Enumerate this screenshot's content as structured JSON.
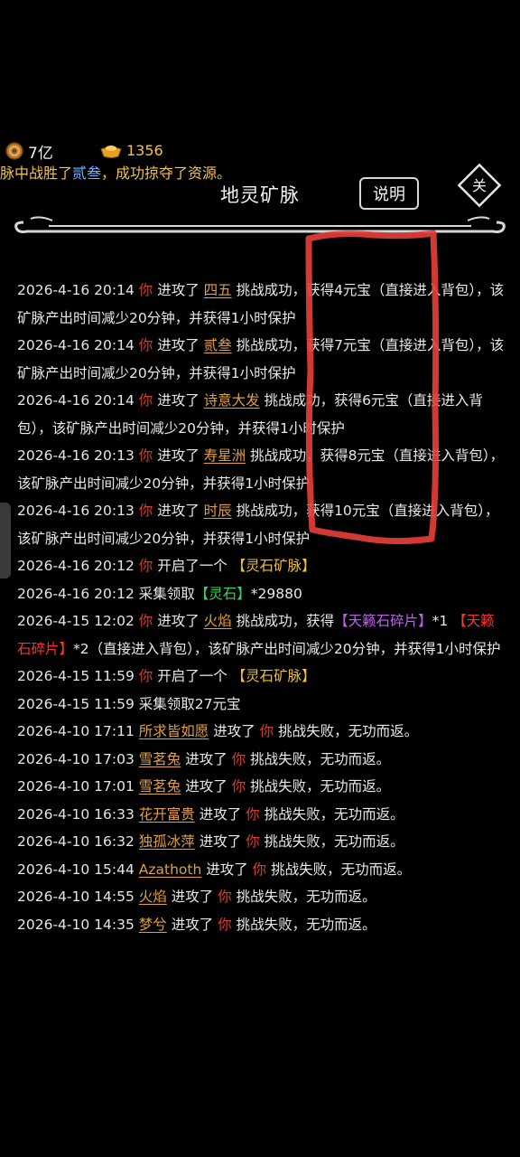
{
  "header": {
    "coins": "7亿",
    "ingots": "1356",
    "ticker_prefix": "脉中战胜了",
    "ticker_name": "贰叁",
    "ticker_suffix": "，成功掠夺了资源。",
    "title": "地灵矿脉",
    "help_label": "说明",
    "close_label": "关"
  },
  "log": {
    "rows": [
      {
        "ts": "2026-4-16 20:14",
        "you": "你",
        "verb": " 进攻了 ",
        "player": "四五",
        "rest": " 挑战成功，获得4元宝（直接进入背包），该矿脉产出时间减少20分钟，并获得1小时保护"
      },
      {
        "ts": "2026-4-16 20:14",
        "you": "你",
        "verb": " 进攻了 ",
        "player": "贰叁",
        "rest": " 挑战成功，获得7元宝（直接进入背包），该矿脉产出时间减少20分钟，并获得1小时保护"
      },
      {
        "ts": "2026-4-16 20:14",
        "you": "你",
        "verb": " 进攻了 ",
        "player": "诗意大发",
        "rest": " 挑战成功，获得6元宝（直接进入背包），该矿脉产出时间减少20分钟，并获得1小时保护"
      },
      {
        "ts": "2026-4-16 20:13",
        "you": "你",
        "verb": " 进攻了 ",
        "player": "寿星洲",
        "rest": " 挑战成功，获得8元宝（直接进入背包），该矿脉产出时间减少20分钟，并获得1小时保护"
      },
      {
        "ts": "2026-4-16 20:13",
        "you": "你",
        "verb": " 进攻了 ",
        "player": "时辰",
        "rest": " 挑战成功，获得10元宝（直接进入背包），该矿脉产出时间减少20分钟，并获得1小时保护"
      }
    ],
    "open1": {
      "ts": "2026-4-16 20:12",
      "you": "你",
      "text": " 开启了一个 ",
      "item": "【灵石矿脉】"
    },
    "collect1": {
      "ts": "2026-4-16 20:12",
      "text": " 采集领取",
      "item": "【灵石】",
      "qty": "*29880"
    },
    "fire": {
      "ts": "2026-4-15 12:02",
      "you": "你",
      "verb": " 进攻了 ",
      "player": "火焰",
      "mid": " 挑战成功，获得",
      "item1": "【天籁石碎片】",
      "q1": "*1",
      "item2": "【天籁石碎片】",
      "rest": "*2（直接进入背包），该矿脉产出时间减少20分钟，并获得1小时保护"
    },
    "open2": {
      "ts": "2026-4-15 11:59",
      "you": "你",
      "text": " 开启了一个 ",
      "item": "【灵石矿脉】"
    },
    "collect2": {
      "ts": "2026-4-15 11:59",
      "text": " 采集领取27元宝"
    },
    "fails": [
      {
        "ts": "2026-4-10 17:11",
        "player": "所求皆如愿",
        "verb": " 进攻了 ",
        "you": "你",
        "rest": " 挑战失败，无功而返。"
      },
      {
        "ts": "2026-4-10 17:03",
        "player": "雪茗兔",
        "verb": " 进攻了 ",
        "you": "你",
        "rest": " 挑战失败，无功而返。"
      },
      {
        "ts": "2026-4-10 17:01",
        "player": "雪茗兔",
        "verb": " 进攻了 ",
        "you": "你",
        "rest": " 挑战失败，无功而返。"
      },
      {
        "ts": "2026-4-10 16:33",
        "player": "花开富贵",
        "verb": " 进攻了 ",
        "you": "你",
        "rest": " 挑战失败，无功而返。"
      },
      {
        "ts": "2026-4-10 16:32",
        "player": "独孤冰萍",
        "verb": " 进攻了 ",
        "you": "你",
        "rest": " 挑战失败，无功而返。"
      },
      {
        "ts": "2026-4-10 15:44",
        "player": "Azathoth",
        "verb": " 进攻了 ",
        "you": "你",
        "rest": " 挑战失败，无功而返。"
      },
      {
        "ts": "2026-4-10 14:55",
        "player": "火焰",
        "verb": " 进攻了 ",
        "you": "你",
        "rest": " 挑战失败，无功而返。"
      },
      {
        "ts": "2026-4-10 14:35",
        "player": "梦兮",
        "verb": " 进攻了 ",
        "you": "你",
        "rest": " 挑战失败，无功而返。"
      }
    ]
  },
  "colors": {
    "you": "#e03a2a",
    "player": "#e0a040",
    "gold": "#f0c030",
    "green": "#3ed35a",
    "purple": "#c060f0",
    "item_red": "#ff3030",
    "annotation": "#e8403a"
  },
  "icons": {
    "coin": "coin-icon",
    "ingot": "gold-ingot-icon",
    "close": "close-icon"
  }
}
